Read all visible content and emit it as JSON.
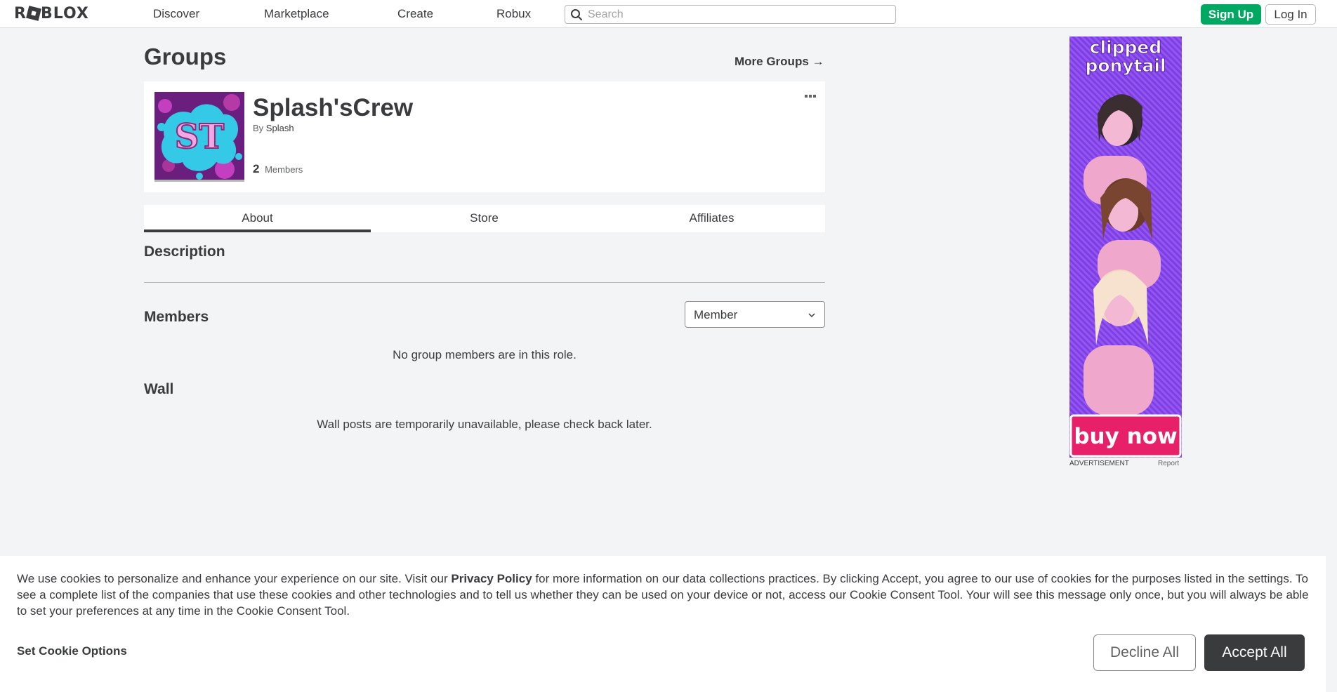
{
  "header": {
    "logo": "ROBLOX",
    "nav": [
      "Discover",
      "Marketplace",
      "Create",
      "Robux"
    ],
    "search_placeholder": "Search",
    "signup_label": "Sign Up",
    "login_label": "Log In"
  },
  "page": {
    "title": "Groups",
    "more_groups": "More Groups →"
  },
  "group": {
    "emblem_text": "ST",
    "name": "Splash'sCrew",
    "by_prefix": "By",
    "owner": "Splash",
    "member_count": "2",
    "member_label": "Members"
  },
  "tabs": [
    {
      "label": "About"
    },
    {
      "label": "Store"
    },
    {
      "label": "Affiliates"
    }
  ],
  "sections": {
    "description_title": "Description",
    "members_title": "Members",
    "role_selected": "Member",
    "members_empty": "No group members are in this role.",
    "wall_title": "Wall",
    "wall_message": "Wall posts are temporarily unavailable, please check back later."
  },
  "ad": {
    "headline_line1": "clipped",
    "headline_line2": "ponytail",
    "cta": "buy now",
    "label": "ADVERTISEMENT",
    "report": "Report"
  },
  "cookie": {
    "text_before_link": "We use cookies to personalize and enhance your experience on our site. Visit our ",
    "privacy_link": "Privacy Policy",
    "text_after_link": " for more information on our data collections practices. By clicking Accept, you agree to our use of cookies for the purposes listed in the settings. To see a complete list of the companies that use these cookies and other technologies and to tell us whether they can be used on your device or not, access our Cookie Consent Tool. Your will see this message only once, but you will always be able to set your preferences at any time in the Cookie Consent Tool.",
    "options_label": "Set Cookie Options",
    "decline_label": "Decline All",
    "accept_label": "Accept All"
  },
  "colors": {
    "signup_green": "#00a862",
    "text_dark": "#393b3d",
    "background": "#f2f4f5"
  }
}
